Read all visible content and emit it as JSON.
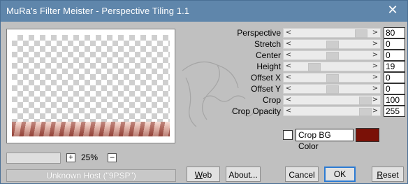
{
  "window": {
    "title": "MuRa's Filter Meister - Perspective Tiling 1.1",
    "close_glyph": "✕",
    "colors": {
      "titlebar": "#5f86ab",
      "dialog_bg": "#c0c0c0"
    }
  },
  "preview": {
    "zoom": {
      "value": "25%",
      "plus": "+",
      "minus": "–"
    },
    "host_status": "Unknown Host (\"9PSP\")"
  },
  "params": [
    {
      "label": "Perspective",
      "value": "80",
      "level": 0.85
    },
    {
      "label": "Stretch",
      "value": "0",
      "level": 0.5
    },
    {
      "label": "Center",
      "value": "0",
      "level": 0.5
    },
    {
      "label": "Height",
      "value": "19",
      "level": 0.2
    },
    {
      "label": "Offset X",
      "value": "0",
      "level": 0.5
    },
    {
      "label": "Offset Y",
      "value": "0",
      "level": 0.5
    },
    {
      "label": "Crop",
      "value": "100",
      "level": 1.0
    },
    {
      "label": "Crop Opacity",
      "value": "255",
      "level": 1.0
    }
  ],
  "crop_bg": {
    "label": "Crop BG Color",
    "checked": false,
    "swatch_color": "#7a1107"
  },
  "buttons": {
    "web": "Web",
    "about": "About...",
    "cancel": "Cancel",
    "ok": "OK",
    "reset": "Reset"
  },
  "icons": {
    "close": "close-icon",
    "arrow_left": "arrow-left-icon",
    "arrow_right": "arrow-right-icon"
  },
  "arrows": {
    "left": "<",
    "right": ">"
  }
}
